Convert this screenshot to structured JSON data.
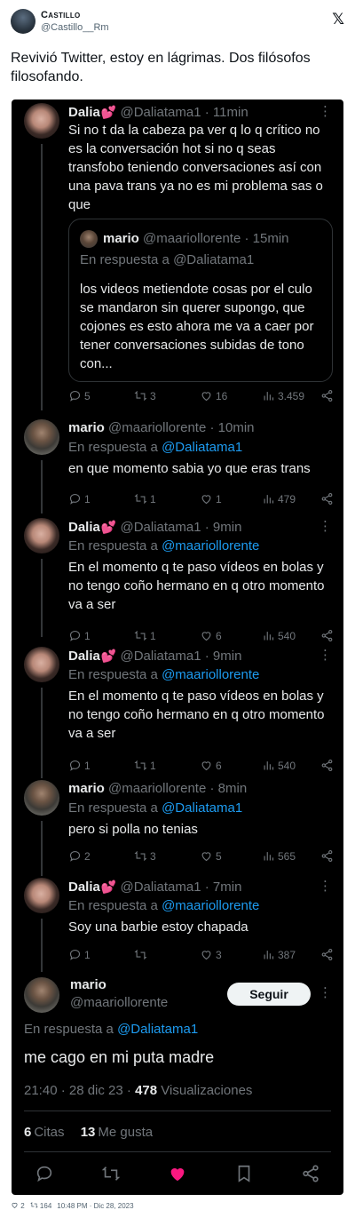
{
  "outer": {
    "author_name": "Castillo",
    "author_handle": "@Castillo__Rm",
    "text": "Revivió Twitter, estoy en lágrimas. Dos filósofos filosofando."
  },
  "colors": {
    "accent": "#1d9bf0",
    "like": "#f91880",
    "background": "#000000"
  },
  "tweets": [
    {
      "name": "Dalia",
      "emoji": "💕",
      "handle": "@Daliatama1",
      "time": "11min",
      "body": "Si no t da la cabeza pa ver q lo q crítico no es la conversación hot si no q seas transfobo teniendo conversaciones así con una pava trans ya no es mi problema sas o que",
      "replies": "5",
      "retweets": "3",
      "likes": "16",
      "views": "3.459"
    },
    {
      "name": "mario",
      "handle": "@maariollorente",
      "time": "10min",
      "reply_prefix": "En respuesta a",
      "reply_to": "@Daliatama1",
      "body": "en que momento sabia yo que eras trans",
      "replies": "1",
      "retweets": "1",
      "likes": "1",
      "views": "479"
    },
    {
      "name": "Dalia",
      "emoji": "💕",
      "handle": "@Daliatama1",
      "time": "9min",
      "reply_prefix": "En respuesta a",
      "reply_to": "@maariollorente",
      "body": "En el momento q te paso vídeos en bolas y no tengo coño hermano en q otro momento va a ser",
      "replies": "1",
      "retweets": "1",
      "likes": "6",
      "views": "540"
    },
    {
      "name": "Dalia",
      "emoji": "💕",
      "handle": "@Daliatama1",
      "time": "9min",
      "reply_prefix": "En respuesta a",
      "reply_to": "@maariollorente",
      "body": "En el momento q te paso vídeos en bolas y no tengo coño hermano en q otro momento va a ser",
      "replies": "1",
      "retweets": "1",
      "likes": "6",
      "views": "540"
    },
    {
      "name": "mario",
      "handle": "@maariollorente",
      "time": "8min",
      "reply_prefix": "En respuesta a",
      "reply_to": "@Daliatama1",
      "body": "pero si polla no tenias",
      "replies": "2",
      "retweets": "3",
      "likes": "5",
      "views": "565"
    },
    {
      "name": "Dalia",
      "emoji": "💕",
      "handle": "@Daliatama1",
      "time": "7min",
      "reply_prefix": "En respuesta a",
      "reply_to": "@maariollorente",
      "body": "Soy una barbie estoy chapada",
      "replies": "1",
      "retweets": "",
      "likes": "3",
      "views": "387"
    }
  ],
  "quote": {
    "name": "mario",
    "handle": "@maariollorente",
    "time": "15min",
    "reply_text": "En respuesta a @Daliatama1",
    "body": "los videos metiendote cosas por el culo se mandaron sin querer supongo, que cojones es esto ahora me va a caer por tener conversaciones subidas de tono con..."
  },
  "main_tweet": {
    "name": "mario",
    "handle": "@maariollorente",
    "follow_label": "Seguir",
    "reply_prefix": "En respuesta a",
    "reply_to": "@Daliatama1",
    "text": "me cago en mi puta madre",
    "timestamp": "21:40 · 28 dic 23 ·",
    "views_count": "478",
    "views_label": "Visualizaciones",
    "quotes_count": "6",
    "quotes_label": "Citas",
    "likes_count": "13",
    "likes_label": "Me gusta"
  },
  "footer": {
    "likes": "2",
    "retweets": "164",
    "datetime": "10:48 PM · Dic 28, 2023"
  },
  "icons": [
    "x-logo-icon",
    "reply-icon",
    "retweet-icon",
    "like-icon",
    "views-icon",
    "share-icon",
    "more-icon"
  ]
}
